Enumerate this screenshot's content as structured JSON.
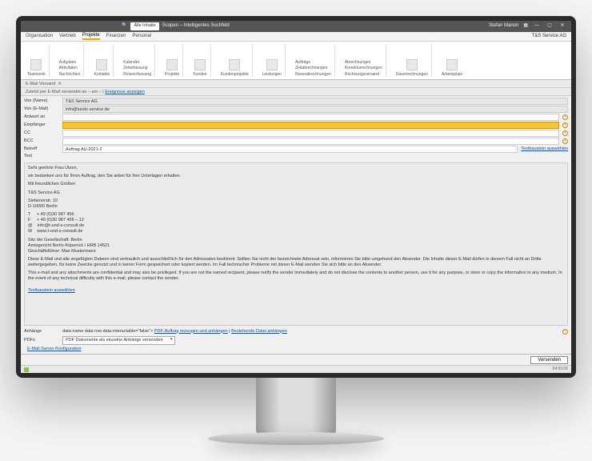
{
  "window": {
    "search_placeholder": "Alle Inhalte",
    "app_title": "Scopen – Intelligentes Suchfeld",
    "user": "Stefan Manon",
    "company": "T&S Service AG"
  },
  "ribbon_tabs": [
    "Organisation",
    "Vertrieb",
    "Projekte",
    "Finanzen",
    "Personal"
  ],
  "ribbon_active_index": 2,
  "ribbon_groups": {
    "g1": "Teamwork",
    "g2_items": [
      "Aufgaben",
      "Aktivitäten",
      "Nachrichten"
    ],
    "g3": "Kontakte",
    "g4_items": [
      "Kalender",
      "Zeiterfassung",
      "Reiseerfassung"
    ],
    "g5": "Projekte",
    "g6": "Kunden",
    "g7": "Kundenprojekte",
    "g8": "Leistungen",
    "g9_items": [
      "Aufträge",
      "Zeitabrechnungen",
      "Reiseabrechnungen"
    ],
    "g10_items": [
      "Abrechnungen",
      "Korrekturrechnungen",
      "Rechnungsversand"
    ],
    "g11": "Dauerrechnungen",
    "g12": "Arbeitsplatz"
  },
  "context": {
    "tab_title": "E-Mail Versand",
    "prefix": "Zuletzt per E-Mail versendet an – am – | ",
    "link": "Ereignisse anzeigen"
  },
  "form": {
    "labels": {
      "from_name": "Von (Name)",
      "from_mail": "Von (E-Mail)",
      "reply_to": "Antwort an",
      "to": "Empfänger",
      "cc": "CC",
      "bcc": "BCC",
      "subject": "Betreff",
      "text": "Text"
    },
    "from_name": "T&S Service AG",
    "from_mail": "info@tunds-service.de",
    "reply_to": "",
    "to": "",
    "cc": "",
    "bcc": "",
    "subject": "Auftrag AU-2021-2",
    "textbaustein_link": "Textbaustein auswählen"
  },
  "body": {
    "greeting": "Sehr geehrte Frau Utzen,",
    "line1": "wir bedanken uns für Ihren Auftrag, den Sie anbei für Ihre Unterlagen erhalten.",
    "signoff": "Mit freundlichen Grüßen",
    "sig_company": "T&S Service AG",
    "sig_street": "Siebenerstr. 10",
    "sig_city": "D-10000 Berlin",
    "sig_tel": "T     + 49 (0)30 987 456",
    "sig_fax": "F     + 49 (0)30 987 456 – 12",
    "sig_mail": "@    info@t-und-s-consult.de",
    "sig_web": "W    www.t-und-s-consult.de",
    "sig_legal1": "Sitz der Gesellschaft: Berlin",
    "sig_legal2": "Amtsgericht Berlin-Köpenick / HRB 14521",
    "sig_legal3": "Geschäftsführer: Max Mustermann",
    "disclaimer_de": "Diese E-Mail und alle angefügten Dateien sind vertraulich und ausschließlich für den Adressaten bestimmt. Sollten Sie nicht der bezeichnete Adressat sein, informieren Sie bitte umgehend den Absender. Die Inhalte dieser E-Mail dürfen in diesem Fall nicht an Dritte weitergegeben, für keine Zwecke genutzt und in keiner Form gespeichert oder kopiert werden. Im Fall technischer Probleme mit dieser E-Mail wenden Sie sich bitte an den Absender.",
    "disclaimer_en": "This e-mail and any attachments are confidential and may also be privileged. If you are not the named recipient, please notify the sender immediately and do not disclose the contents to another person, use it for any purpose, or store or copy the information in any medium. In the event of any technical difficulty with this e-mail, please contact the sender.",
    "textbaustein_link": "Textbaustein auswählen"
  },
  "attachments": {
    "label": "Anhänge",
    "link1": "PDF-Auftrag erzeugen und anhängen",
    "sep": " | ",
    "link2": "Bestehende Datei anhängen",
    "pdfs_label": "PDFs",
    "dropdown_value": "PDF Dokumente als einzelne Anhänge versenden",
    "config_link": "E-Mail-Server Konfiguration"
  },
  "footer": {
    "send": "Versenden",
    "status_right": "04:59:00"
  }
}
